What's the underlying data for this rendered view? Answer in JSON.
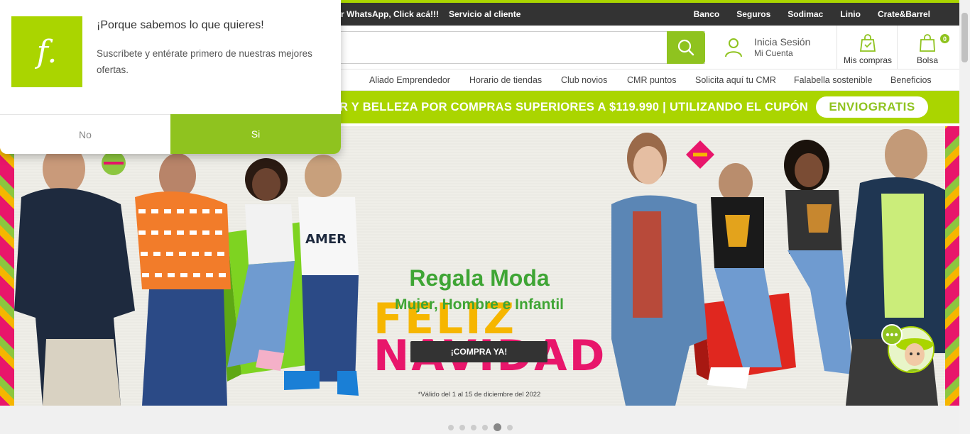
{
  "topbar": {
    "left_link": "r WhatsApp, Click acá!!!",
    "service": "Servicio al cliente",
    "links": [
      "Banco",
      "Seguros",
      "Sodimac",
      "Linio",
      "Crate&Barrel"
    ]
  },
  "header": {
    "search_placeholder": "",
    "login_line1": "Inicia Sesión",
    "login_line2": "Mi Cuenta",
    "purchases": "Mis compras",
    "bag": "Bolsa",
    "bag_count": "0"
  },
  "nav": {
    "items": [
      "Aliado Emprendedor",
      "Horario de tiendas",
      "Club novios",
      "CMR puntos",
      "Solicita aquí tu CMR",
      "Falabella sostenible",
      "Beneficios"
    ]
  },
  "promo": {
    "text": "R Y BELLEZA POR COMPRAS SUPERIORES A $119.990 | UTILIZANDO EL CUPÓN",
    "coupon": "ENVIOGRATIS"
  },
  "banner": {
    "line1": "FELIZ",
    "line2": "NAVIDAD",
    "headline": "Regala Moda",
    "subhead": "Mujer, Hombre e Infantil",
    "cta": "¡COMPRA YA!",
    "validity": "*Válido del 1 al 15 de diciembre del 2022",
    "kid_shirt_text": "AMER"
  },
  "carousel": {
    "count": 6,
    "active": 5
  },
  "popup": {
    "logo_letter": "f.",
    "title": "¡Porque sabemos lo que quieres!",
    "body": "Suscríbete y entérate primero de nuestras mejores ofertas.",
    "no": "No",
    "yes": "Si"
  },
  "colors": {
    "brand_green": "#aad500",
    "button_green": "#8fc31f",
    "dark": "#333333",
    "text_green": "#3fa535",
    "festive_pink": "#e8166b"
  }
}
